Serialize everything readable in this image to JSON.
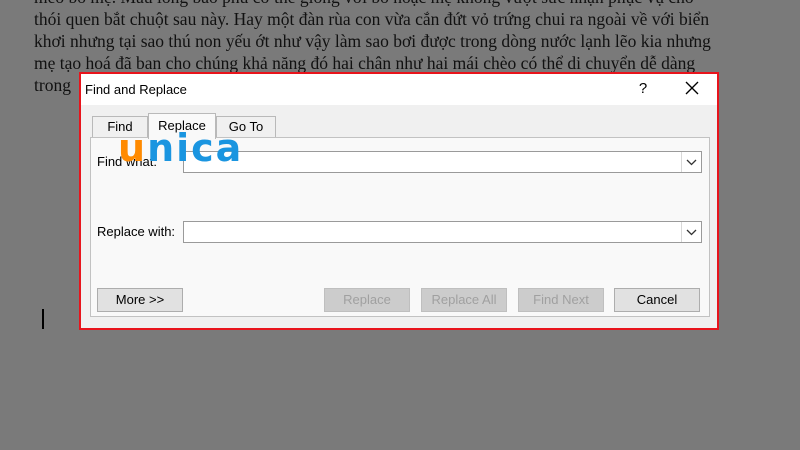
{
  "document": {
    "lines": [
      "mèo bố mẹ. Màu lông bảo phủ cơ thể giống với bố hoặc mẹ không vượt sức nhận phục vụ cho",
      "thói quen bắt chuột sau này. Hay một đàn rùa con vừa cắn đứt vỏ trứng chui ra ngoài về với biển",
      "khơi nhưng tại sao thú non yếu ớt như vậy làm sao bơi được trong dòng nước lạnh lẽo kia nhưng",
      "mẹ tạo hoá đã ban cho chúng khả năng đó hai chân như hai mái chèo có thể di chuyển dễ dàng",
      "trong"
    ]
  },
  "dialog": {
    "title": "Find and Replace",
    "help": "?",
    "tabs": [
      {
        "label": "Find",
        "active": false
      },
      {
        "label": "Replace",
        "active": true
      },
      {
        "label": "Go To",
        "active": false
      }
    ],
    "find_label": "Find what:",
    "find_value": "",
    "replace_label": "Replace with:",
    "replace_value": "",
    "buttons": {
      "more": "More >>",
      "replace": "Replace",
      "replace_all": "Replace All",
      "find_next": "Find Next",
      "cancel": "Cancel"
    }
  },
  "watermark": {
    "first": "u",
    "rest": "nica"
  },
  "colors": {
    "highlight_border": "#e8141c",
    "watermark_orange": "#ff8a00",
    "watermark_blue": "#1a95e0"
  }
}
